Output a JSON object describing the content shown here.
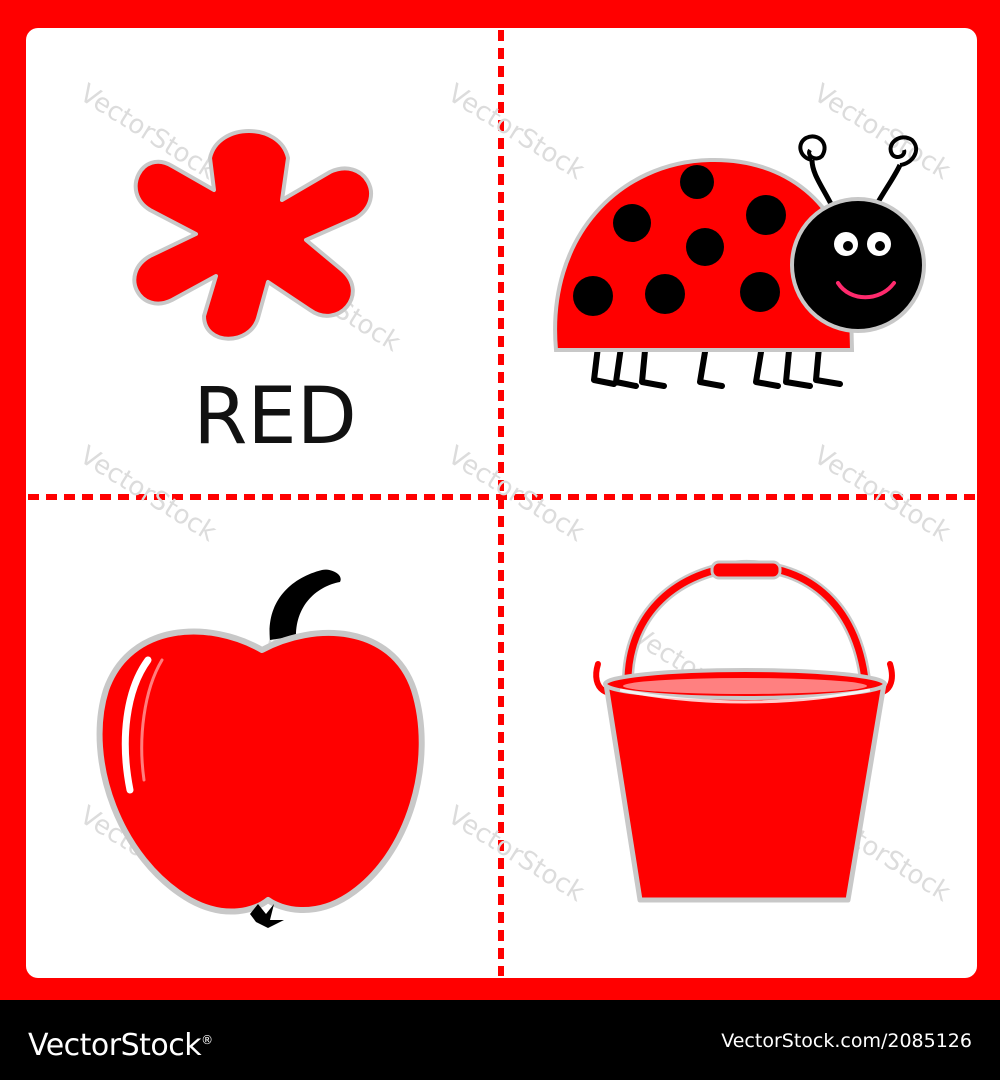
{
  "card": {
    "color_word": "RED",
    "frame_color": "#ff0000",
    "panel_color": "#ffffff",
    "divider_color": "#ff0000"
  },
  "illustrations": [
    {
      "name": "paint-splash-icon",
      "color": "#ff0000"
    },
    {
      "name": "ladybug-icon",
      "color": "#ff0000",
      "spot_color": "#000000"
    },
    {
      "name": "apple-icon",
      "color": "#ff0000"
    },
    {
      "name": "bucket-icon",
      "color": "#ff0000"
    }
  ],
  "watermark": {
    "text": "VectorStock"
  },
  "footer": {
    "logo_text": "VectorStock",
    "logo_mark": "®",
    "url_text": "VectorStock.com/2085126",
    "background": "#000000",
    "text_color": "#ffffff"
  }
}
